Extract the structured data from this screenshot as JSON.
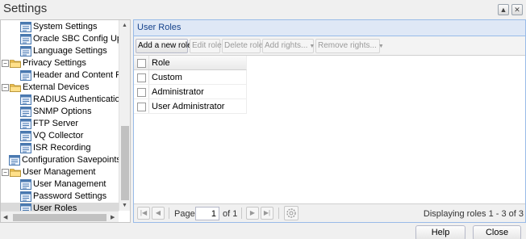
{
  "window": {
    "title": "Settings"
  },
  "tree": {
    "items": [
      {
        "label": "System Settings",
        "icon": "page-icon"
      },
      {
        "label": "Oracle SBC Config Upload",
        "icon": "page-icon"
      },
      {
        "label": "Language Settings",
        "icon": "page-icon"
      },
      {
        "label": "Privacy Settings",
        "icon": "folder-icon",
        "expander": "−"
      },
      {
        "label": "Header and Content Privacy",
        "icon": "page-icon"
      },
      {
        "label": "External Devices",
        "icon": "folder-icon",
        "expander": "−"
      },
      {
        "label": "RADIUS Authentication",
        "icon": "page-icon"
      },
      {
        "label": "SNMP Options",
        "icon": "page-icon"
      },
      {
        "label": "FTP Server",
        "icon": "page-icon"
      },
      {
        "label": "VQ Collector",
        "icon": "page-icon"
      },
      {
        "label": "ISR Recording",
        "icon": "page-icon"
      },
      {
        "label": "Configuration Savepoints",
        "icon": "page-icon"
      },
      {
        "label": "User Management",
        "icon": "folder-icon",
        "expander": "−"
      },
      {
        "label": "User Management",
        "icon": "page-icon"
      },
      {
        "label": "Password Settings",
        "icon": "page-icon"
      },
      {
        "label": "User Roles",
        "icon": "page-icon",
        "selected": true
      }
    ]
  },
  "panel": {
    "title": "User Roles",
    "toolbar": {
      "add": "Add a new role",
      "edit": "Edit role",
      "delete": "Delete role",
      "add_rights": "Add rights...",
      "remove_rights": "Remove rights..."
    },
    "grid": {
      "header": "Role",
      "rows": [
        "Custom",
        "Administrator",
        "User Administrator"
      ]
    },
    "paging": {
      "page_label": "Page",
      "page_value": "1",
      "of_label": "of 1",
      "display": "Displaying roles 1 - 3 of 3"
    }
  },
  "buttons": {
    "help": "Help",
    "close": "Close"
  },
  "colors": {
    "header_bg": "#dfe8f6",
    "header_text": "#15428b",
    "folder": "#f5c451",
    "page_icon": "#4a79b0"
  }
}
